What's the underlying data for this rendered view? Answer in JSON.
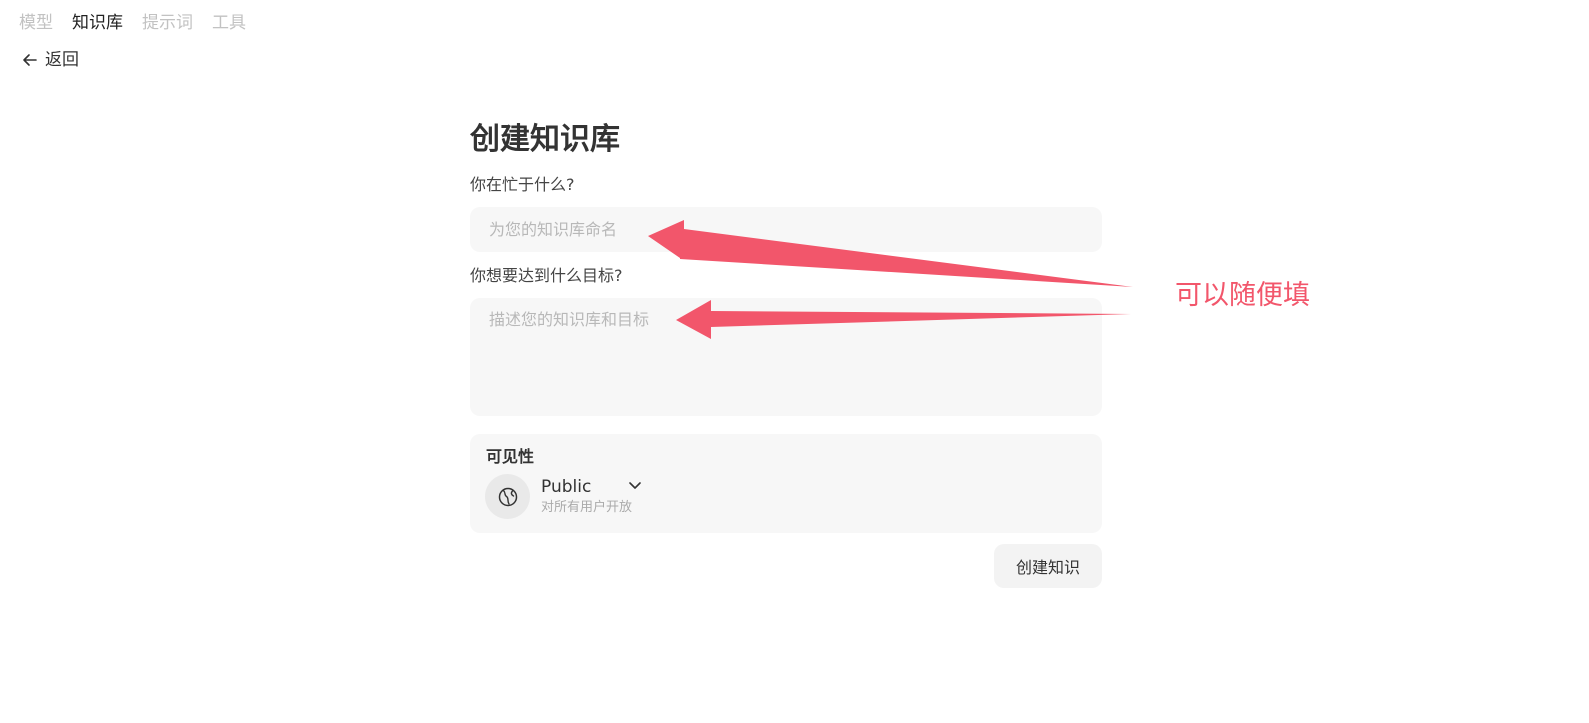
{
  "nav": {
    "tabs": [
      {
        "label": "模型",
        "active": false
      },
      {
        "label": "知识库",
        "active": true
      },
      {
        "label": "提示词",
        "active": false
      },
      {
        "label": "工具",
        "active": false
      }
    ],
    "back_label": "返回",
    "back_icon": "arrow-left-icon"
  },
  "form": {
    "title": "创建知识库",
    "name_label": "你在忙于什么?",
    "name_placeholder": "为您的知识库命名",
    "name_value": "",
    "goal_label": "你想要达到什么目标?",
    "goal_placeholder": "描述您的知识库和目标",
    "goal_value": "",
    "visibility": {
      "title": "可见性",
      "icon": "globe-icon",
      "selected": "Public",
      "description": "对所有用户开放"
    },
    "submit_label": "创建知识"
  },
  "annotation": {
    "text": "可以随便填",
    "color": "#f2566b"
  }
}
